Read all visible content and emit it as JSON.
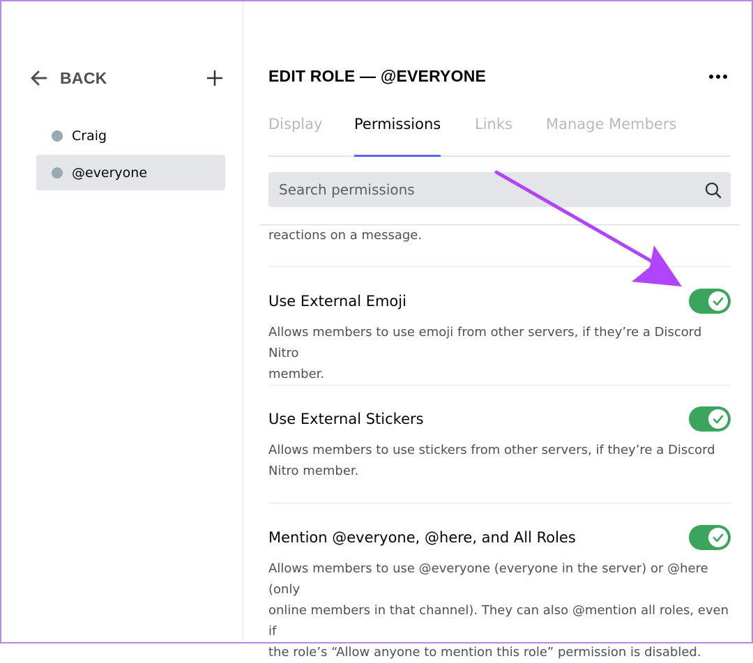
{
  "sidebar": {
    "back_label": "BACK",
    "roles": [
      {
        "name": "Craig",
        "color": "#99aab5",
        "selected": false
      },
      {
        "name": "@everyone",
        "color": "#99aab5",
        "selected": true
      }
    ]
  },
  "header": {
    "title": "EDIT ROLE — @EVERYONE"
  },
  "tabs": [
    {
      "label": "Display",
      "active": false
    },
    {
      "label": "Permissions",
      "active": true
    },
    {
      "label": "Links",
      "active": false
    },
    {
      "label": "Manage Members",
      "active": false
    }
  ],
  "search": {
    "placeholder": "Search permissions"
  },
  "permissions": {
    "previous_desc_tail": "reactions on a message.",
    "items": [
      {
        "title": "Use External Emoji",
        "desc_line1": "Allows members to use emoji from other servers, if they’re a Discord Nitro",
        "desc_line2": "member.",
        "enabled": true
      },
      {
        "title": "Use External Stickers",
        "desc_line1": "Allows members to use stickers from other servers, if they’re a Discord",
        "desc_line2": "Nitro member.",
        "enabled": true
      },
      {
        "title": "Mention @everyone, @here, and All Roles",
        "desc_line1": "Allows members to use @everyone (everyone in the server) or @here (only",
        "desc_line2": "online members in that channel). They can also @mention all roles, even if",
        "desc_line3": "the role’s “Allow anyone to mention this role” permission is disabled.",
        "enabled": true
      }
    ]
  },
  "colors": {
    "toggle_on": "#3ba55d",
    "tab_active_underline": "#5865f2",
    "annotation_arrow": "#b044ff"
  },
  "icons": {
    "back": "arrow-left-icon",
    "add": "plus-icon",
    "more": "more-horizontal-icon",
    "search": "search-icon",
    "check": "check-icon"
  }
}
